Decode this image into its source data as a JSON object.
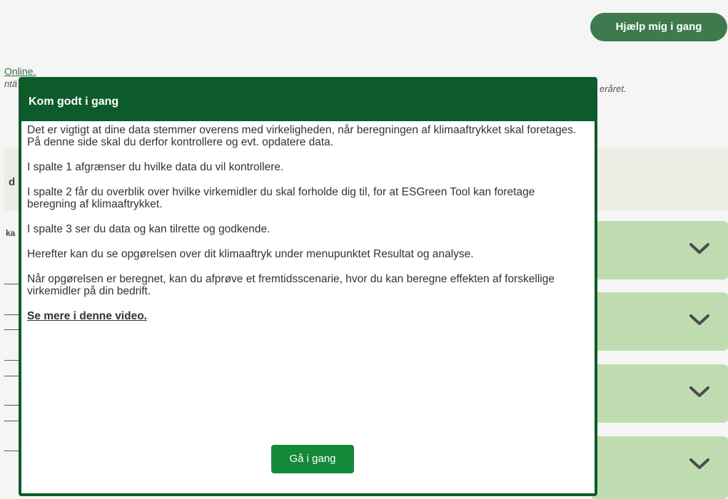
{
  "header": {
    "help_button_label": "Hjælp mig i gang"
  },
  "background": {
    "link_text": "Online.",
    "italic_left": "ntä",
    "italic_right": "eråret.",
    "band_letter": "d",
    "small_letters": "ka"
  },
  "modal": {
    "title": "Kom godt i gang",
    "paragraphs": [
      "Det er vigtigt at dine data stemmer overens med virkeligheden, når beregningen af klimaaftrykket skal foretages. På denne side skal du derfor kontrollere og evt. opdatere data.",
      "I spalte 1 afgrænser du hvilke data du vil kontrollere.",
      "I spalte 2 får du overblik over hvilke virkemidler du skal forholde dig til, for at ESGreen Tool kan foretage beregning af klimaaftrykket.",
      "I spalte 3 ser du data og kan tilrette og godkende.",
      "Herefter kan du se opgørelsen over dit klimaaftryk under menupunktet Resultat og analyse.",
      "Når opgørelsen er beregnet, kan du afprøve et fremtidsscenarie, hvor du kan beregne effekten af forskellige virkemidler på din bedrift."
    ],
    "video_link": "Se mere i denne video.",
    "go_button": "Gå i gang"
  },
  "colors": {
    "modal_green": "#0d5b2b",
    "button_green": "#15893a",
    "help_button": "#3f7a4f",
    "accordion_bg": "#bfdcb0"
  },
  "icons": [
    "chevron-down-icon"
  ]
}
